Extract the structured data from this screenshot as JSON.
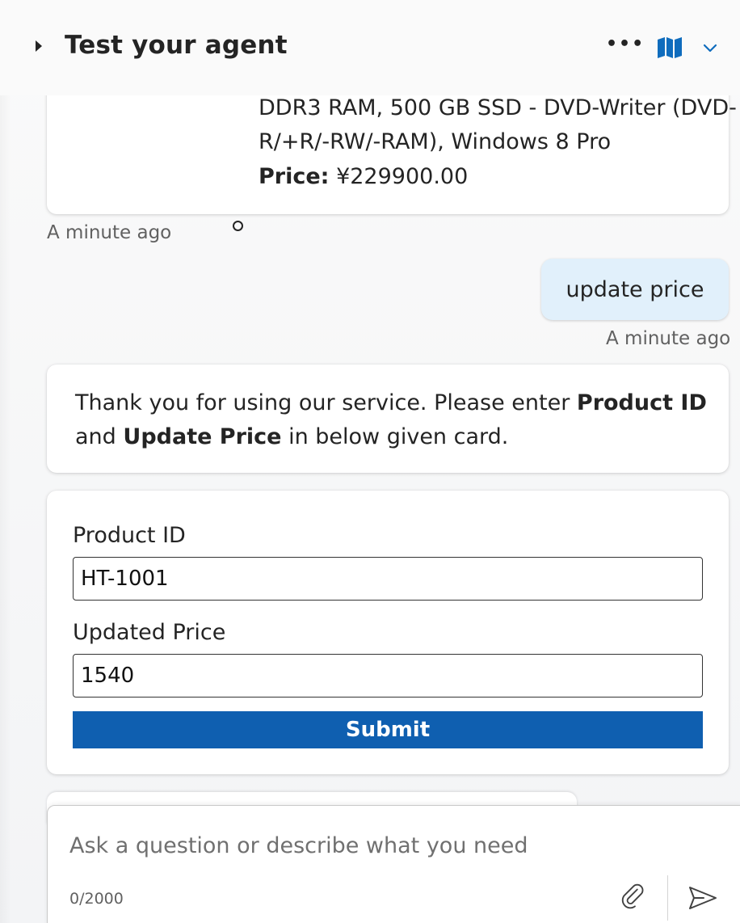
{
  "header": {
    "title": "Test your agent",
    "more_label": "•••",
    "icons": [
      "caret-right-icon",
      "more-icon",
      "map-icon",
      "chevron-down-icon"
    ]
  },
  "messages": {
    "previous_card": {
      "line1": "DDR3 RAM, 500 GB SSD - DVD-Writer (DVD-",
      "line2": "R/+R/-RW/-RAM), Windows 8 Pro",
      "price_label": "Price:",
      "price_value": " ¥229900.00",
      "timestamp": "A minute ago"
    },
    "user": {
      "text": "update price",
      "timestamp": "A minute ago"
    },
    "bot": {
      "part1": "Thank you for using our service. Please enter ",
      "bold1": "Product ID",
      "part2": "and ",
      "bold2": "Update Price",
      "part3": " in below given card."
    },
    "form": {
      "product_id_label": "Product ID",
      "product_id_value": "HT-1001",
      "price_label": "Updated Price",
      "price_value": "1540",
      "submit_label": "Submit"
    }
  },
  "composer": {
    "placeholder": "Ask a question or describe what you need",
    "counter": "0/2000"
  },
  "colors": {
    "accent": "#0f5fb0",
    "user_bubble": "#e1f0fb",
    "icon_blue": "#0f6cbd"
  }
}
